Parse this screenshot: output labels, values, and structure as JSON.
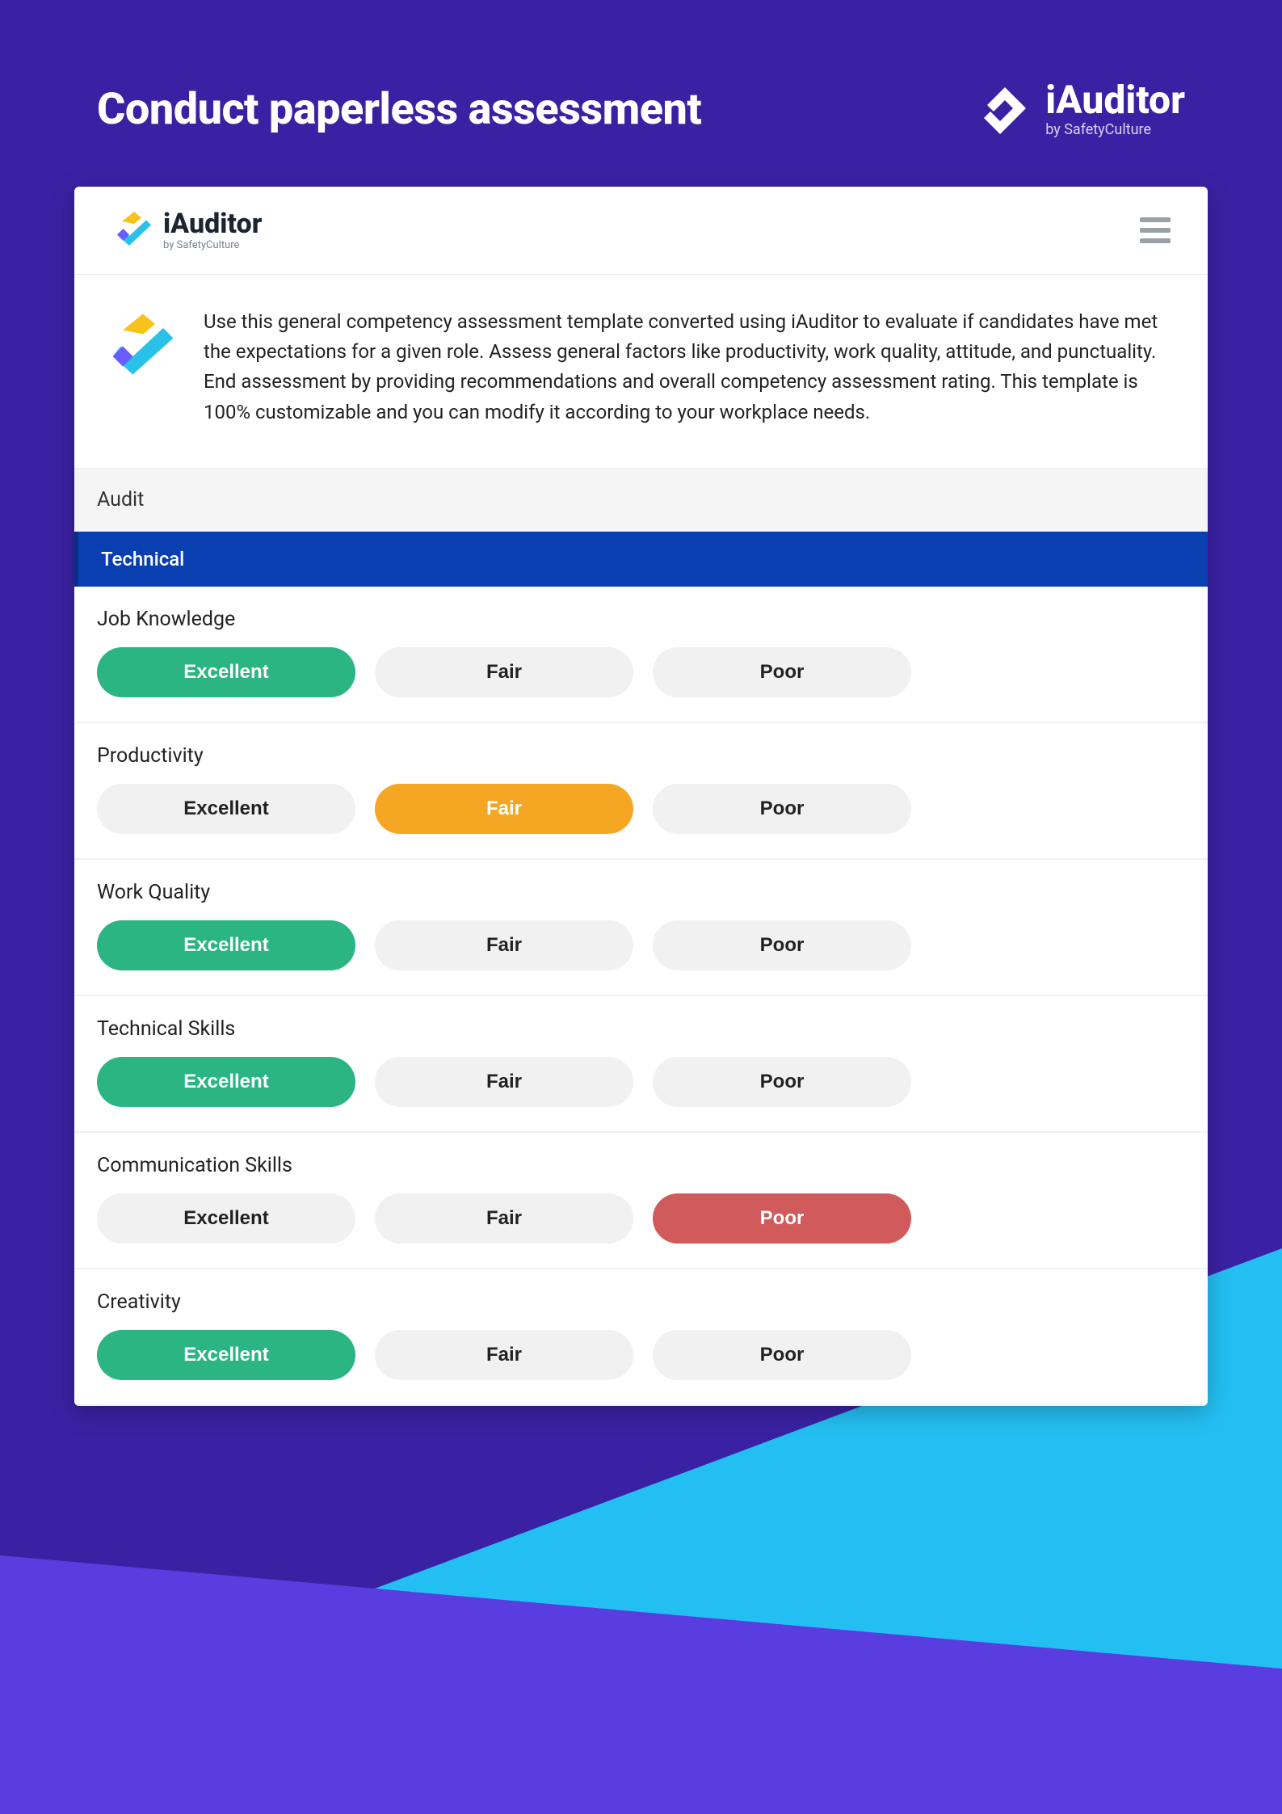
{
  "hero": {
    "title": "Conduct paperless assessment",
    "brand_name": "iAuditor",
    "brand_sub": "by SafetyCulture"
  },
  "app": {
    "brand_name": "iAuditor",
    "brand_sub": "by SafetyCulture",
    "description": "Use this general competency assessment template converted using iAuditor to evaluate if candidates have met the expectations for a given role. Assess general factors like productivity, work quality, attitude, and punctuality. End assessment by providing recommendations and overall competency assessment rating. This template is 100% customizable and you can modify it according to your workplace needs."
  },
  "tabs": {
    "audit": "Audit"
  },
  "section": {
    "title": "Technical"
  },
  "option_labels": {
    "excellent": "Excellent",
    "fair": "Fair",
    "poor": "Poor"
  },
  "questions": [
    {
      "label": "Job Knowledge",
      "selected": "excellent"
    },
    {
      "label": "Productivity",
      "selected": "fair"
    },
    {
      "label": "Work Quality",
      "selected": "excellent"
    },
    {
      "label": "Technical Skills",
      "selected": "excellent"
    },
    {
      "label": "Communication Skills",
      "selected": "poor"
    },
    {
      "label": "Creativity",
      "selected": "excellent"
    }
  ]
}
